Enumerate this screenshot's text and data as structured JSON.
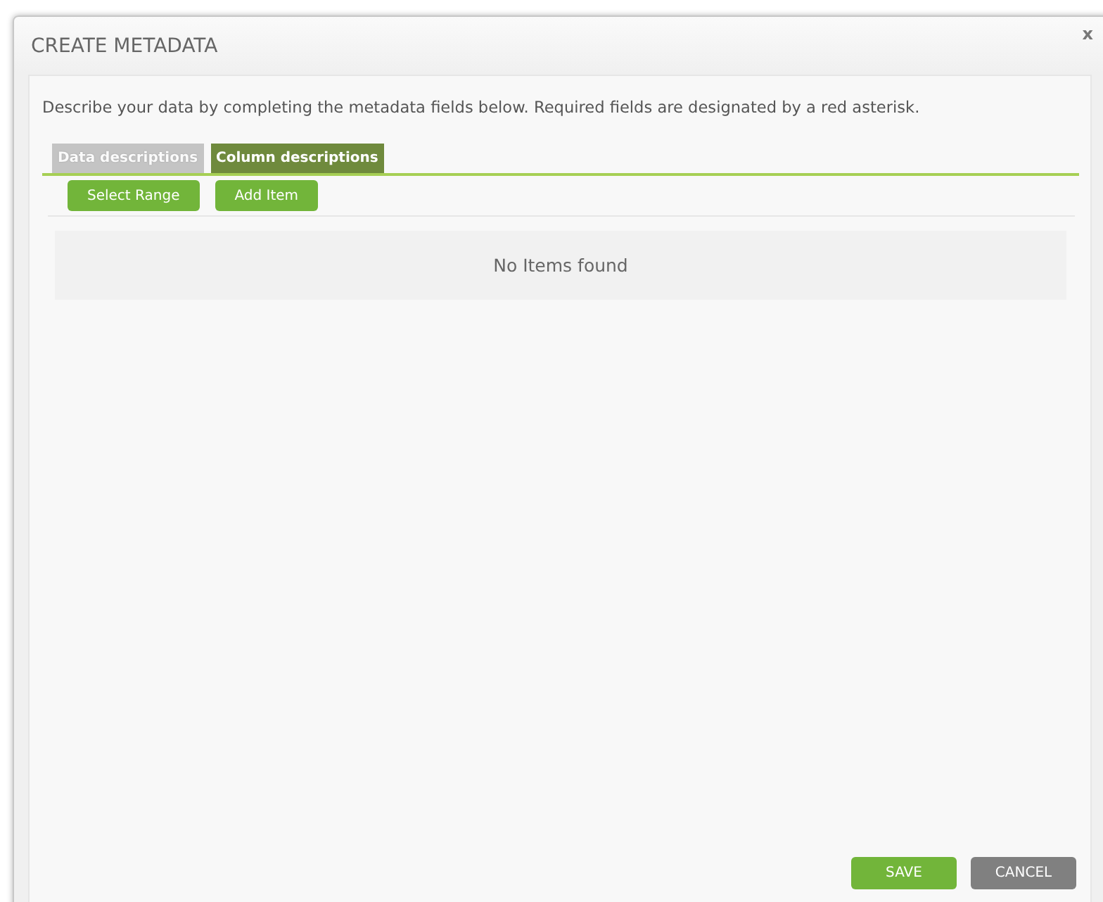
{
  "dialog": {
    "title": "CREATE METADATA",
    "close": "x"
  },
  "description": "Describe your data by completing the metadata fields below. Required fields are designated by a red asterisk.",
  "tabs": [
    {
      "label": "Data descriptions",
      "selected": false
    },
    {
      "label": "Column descriptions",
      "selected": true
    }
  ],
  "toolbar": [
    "Select Range",
    "Add Item"
  ],
  "empty_message": "No Items found",
  "footer_buttons": [
    {
      "label": "SAVE",
      "kind": "primary"
    },
    {
      "label": "CANCEL",
      "kind": "secondary"
    }
  ]
}
